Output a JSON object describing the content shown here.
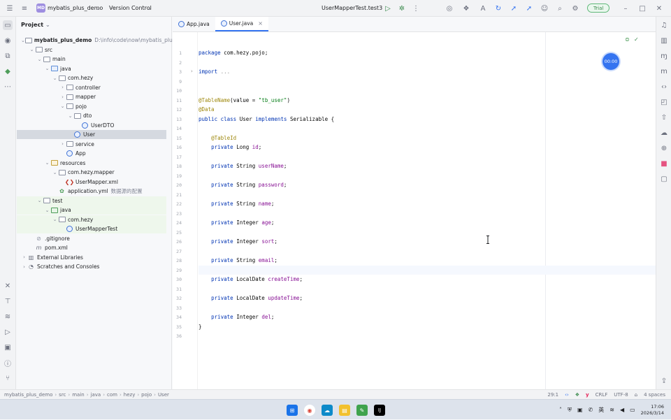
{
  "titlebar": {
    "project_badge": "MD",
    "project_name": "mybatis_plus_demo",
    "vcs_label": "Version Control",
    "run_config": "UserMapperTest.test3",
    "trial_label": "Trial",
    "icons": [
      "hamburger-menu-icon",
      "chevron-down-icon",
      "run-icon",
      "debug-icon",
      "more-icon",
      "translate-icon",
      "refresh-icon",
      "search-icon",
      "settings-icon",
      "minimize-icon",
      "maximize-icon",
      "close-icon"
    ]
  },
  "project_panel": {
    "title": "Project",
    "tree": [
      {
        "label": "mybatis_plus_demo",
        "path": "D:\\info\\code\\now\\mybatis_plus_demo",
        "level": 0,
        "icon": "folder",
        "open": true,
        "bold": true
      },
      {
        "label": "src",
        "level": 1,
        "icon": "folder",
        "open": true
      },
      {
        "label": "main",
        "level": 2,
        "icon": "folder",
        "open": true
      },
      {
        "label": "java",
        "level": 3,
        "icon": "folder-blue",
        "open": true
      },
      {
        "label": "com.hezy",
        "level": 4,
        "icon": "folder",
        "open": true
      },
      {
        "label": "controller",
        "level": 5,
        "icon": "folder",
        "open": false
      },
      {
        "label": "mapper",
        "level": 5,
        "icon": "folder",
        "open": false
      },
      {
        "label": "pojo",
        "level": 5,
        "icon": "folder",
        "open": true
      },
      {
        "label": "dto",
        "level": 6,
        "icon": "folder",
        "open": true
      },
      {
        "label": "UserDTO",
        "level": 7,
        "icon": "class"
      },
      {
        "label": "User",
        "level": 6,
        "icon": "class",
        "selected": true
      },
      {
        "label": "service",
        "level": 5,
        "icon": "folder",
        "open": false
      },
      {
        "label": "App",
        "level": 5,
        "icon": "class"
      },
      {
        "label": "resources",
        "level": 3,
        "icon": "folder-res",
        "open": true
      },
      {
        "label": "com.hezy.mapper",
        "level": 4,
        "icon": "folder",
        "open": true
      },
      {
        "label": "UserMapper.xml",
        "level": 5,
        "icon": "xml"
      },
      {
        "label": "application.yml",
        "note": "数据源的配置",
        "level": 4,
        "icon": "yml"
      },
      {
        "label": "test",
        "level": 2,
        "icon": "folder",
        "open": true,
        "test": true
      },
      {
        "label": "java",
        "level": 3,
        "icon": "folder-green",
        "open": true,
        "test": true
      },
      {
        "label": "com.hezy",
        "level": 4,
        "icon": "folder",
        "open": true,
        "test": true
      },
      {
        "label": "UserMapperTest",
        "level": 5,
        "icon": "class",
        "test": true
      },
      {
        "label": ".gitignore",
        "level": 1,
        "icon": "git"
      },
      {
        "label": "pom.xml",
        "level": 1,
        "icon": "maven"
      },
      {
        "label": "External Libraries",
        "level": 0,
        "icon": "lib",
        "open": false
      },
      {
        "label": "Scratches and Consoles",
        "level": 0,
        "icon": "scratch",
        "open": false
      }
    ]
  },
  "editor": {
    "tabs": [
      {
        "label": "App.java",
        "active": false
      },
      {
        "label": "User.java",
        "active": true
      }
    ],
    "timer": "00:00",
    "lines": [
      {
        "n": "1",
        "tokens": [
          [
            "kw",
            "package "
          ],
          [
            "",
            "com.hezy.pojo;"
          ]
        ]
      },
      {
        "n": "2",
        "tokens": []
      },
      {
        "n": "3",
        "tokens": [
          [
            "kw",
            "import "
          ],
          [
            "fold",
            "..."
          ]
        ]
      },
      {
        "n": "9",
        "tokens": []
      },
      {
        "n": "10",
        "tokens": []
      },
      {
        "n": "11",
        "tokens": [
          [
            "ann",
            "@TableName"
          ],
          [
            "",
            "(value = "
          ],
          [
            "str",
            "\"tb_user\""
          ],
          [
            "",
            ")"
          ]
        ]
      },
      {
        "n": "12",
        "tokens": [
          [
            "ann",
            "@Data"
          ]
        ]
      },
      {
        "n": "13",
        "tokens": [
          [
            "kw",
            "public class "
          ],
          [
            "",
            "User "
          ],
          [
            "kw",
            "implements "
          ],
          [
            "",
            "Serializable {"
          ]
        ]
      },
      {
        "n": "14",
        "tokens": []
      },
      {
        "n": "15",
        "tokens": [
          [
            "",
            "    "
          ],
          [
            "ann",
            "@TableId"
          ]
        ]
      },
      {
        "n": "16",
        "tokens": [
          [
            "",
            "    "
          ],
          [
            "kw",
            "private "
          ],
          [
            "",
            "Long "
          ],
          [
            "fld",
            "id"
          ],
          [
            "",
            ";"
          ]
        ]
      },
      {
        "n": "17",
        "tokens": []
      },
      {
        "n": "18",
        "tokens": [
          [
            "",
            "    "
          ],
          [
            "kw",
            "private "
          ],
          [
            "",
            "String "
          ],
          [
            "fld",
            "userName"
          ],
          [
            "",
            ";"
          ]
        ]
      },
      {
        "n": "19",
        "tokens": []
      },
      {
        "n": "20",
        "tokens": [
          [
            "",
            "    "
          ],
          [
            "kw",
            "private "
          ],
          [
            "",
            "String "
          ],
          [
            "fld",
            "password"
          ],
          [
            "",
            ";"
          ]
        ]
      },
      {
        "n": "21",
        "tokens": []
      },
      {
        "n": "22",
        "tokens": [
          [
            "",
            "    "
          ],
          [
            "kw",
            "private "
          ],
          [
            "",
            "String "
          ],
          [
            "fld",
            "name"
          ],
          [
            "",
            ";"
          ]
        ]
      },
      {
        "n": "23",
        "tokens": []
      },
      {
        "n": "24",
        "tokens": [
          [
            "",
            "    "
          ],
          [
            "kw",
            "private "
          ],
          [
            "",
            "Integer "
          ],
          [
            "fld",
            "age"
          ],
          [
            "",
            ";"
          ]
        ]
      },
      {
        "n": "25",
        "tokens": []
      },
      {
        "n": "26",
        "tokens": [
          [
            "",
            "    "
          ],
          [
            "kw",
            "private "
          ],
          [
            "",
            "Integer "
          ],
          [
            "fld",
            "sort"
          ],
          [
            "",
            ";"
          ]
        ]
      },
      {
        "n": "27",
        "tokens": []
      },
      {
        "n": "28",
        "tokens": [
          [
            "",
            "    "
          ],
          [
            "kw",
            "private "
          ],
          [
            "",
            "String "
          ],
          [
            "fld",
            "email"
          ],
          [
            "",
            ";"
          ]
        ]
      },
      {
        "n": "29",
        "tokens": [],
        "caret": true
      },
      {
        "n": "30",
        "tokens": [
          [
            "",
            "    "
          ],
          [
            "kw",
            "private "
          ],
          [
            "",
            "LocalDate "
          ],
          [
            "fld",
            "createTime"
          ],
          [
            "",
            ";"
          ]
        ]
      },
      {
        "n": "31",
        "tokens": []
      },
      {
        "n": "32",
        "tokens": [
          [
            "",
            "    "
          ],
          [
            "kw",
            "private "
          ],
          [
            "",
            "LocalDate "
          ],
          [
            "fld",
            "updateTime"
          ],
          [
            "",
            ";"
          ]
        ]
      },
      {
        "n": "33",
        "tokens": []
      },
      {
        "n": "34",
        "tokens": [
          [
            "",
            "    "
          ],
          [
            "kw",
            "private "
          ],
          [
            "",
            "Integer "
          ],
          [
            "fld",
            "del"
          ],
          [
            "",
            ";"
          ]
        ]
      },
      {
        "n": "35",
        "tokens": [
          [
            "",
            "}"
          ]
        ]
      },
      {
        "n": "36",
        "tokens": []
      }
    ]
  },
  "statusbar": {
    "breadcrumbs": [
      "mybatis_plus_demo",
      "src",
      "main",
      "java",
      "com",
      "hezy",
      "pojo",
      "User"
    ],
    "position": "29:1",
    "line_ending": "CRLF",
    "encoding": "UTF-8",
    "indent": "4 spaces"
  },
  "taskbar": {
    "ime": "英",
    "time": "17:06",
    "date": "2026/3/14"
  }
}
